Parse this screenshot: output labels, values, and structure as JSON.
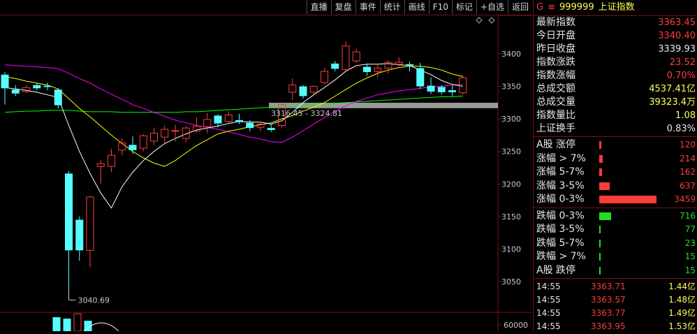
{
  "toolbar": {
    "buttons": [
      "直播",
      "复盘",
      "事件",
      "统计",
      "画线",
      "F10",
      "标记",
      "+自选",
      "返回"
    ]
  },
  "chart": {
    "ytick_labels": [
      "3400",
      "3350",
      "3300",
      "3250",
      "3200",
      "3150",
      "3100",
      "3050"
    ],
    "volume_tick_label": "60000",
    "low_annotation": "3040.69",
    "band_annotation": "3316.45 - 3324.81",
    "colors": {
      "up": "#ff3b3b",
      "down": "#54ffff",
      "ma5": "#ffffff",
      "ma10": "#ffff00",
      "ma20": "#ff00ff",
      "ma60": "#00ff00",
      "grid": "#7a1010",
      "band": "#9a9a9a"
    }
  },
  "chart_data": {
    "type": "candlestick",
    "ylim": [
      3030,
      3430
    ],
    "yticks": [
      3400,
      3350,
      3300,
      3250,
      3200,
      3150,
      3100,
      3050
    ],
    "candles": [
      {
        "o": 3368,
        "c": 3347,
        "h": 3372,
        "l": 3322
      },
      {
        "o": 3345,
        "c": 3339,
        "h": 3352,
        "l": 3335
      },
      {
        "o": 3342,
        "c": 3348,
        "h": 3352,
        "l": 3340
      },
      {
        "o": 3352,
        "c": 3347,
        "h": 3355,
        "l": 3344
      },
      {
        "o": 3351,
        "c": 3349,
        "h": 3356,
        "l": 3344
      },
      {
        "o": 3345,
        "c": 3321,
        "h": 3347,
        "l": 3316
      },
      {
        "o": 3216,
        "c": 3098,
        "h": 3220,
        "l": 3041
      },
      {
        "o": 3145,
        "c": 3098,
        "h": 3150,
        "l": 3082
      },
      {
        "o": 3098,
        "c": 3180,
        "h": 3182,
        "l": 3072
      },
      {
        "o": 3227,
        "c": 3231,
        "h": 3237,
        "l": 3200
      },
      {
        "o": 3227,
        "c": 3244,
        "h": 3254,
        "l": 3218
      },
      {
        "o": 3252,
        "c": 3263,
        "h": 3270,
        "l": 3244
      },
      {
        "o": 3260,
        "c": 3252,
        "h": 3273,
        "l": 3246
      },
      {
        "o": 3255,
        "c": 3274,
        "h": 3277,
        "l": 3250
      },
      {
        "o": 3266,
        "c": 3278,
        "h": 3286,
        "l": 3260
      },
      {
        "o": 3272,
        "c": 3284,
        "h": 3290,
        "l": 3262
      },
      {
        "o": 3281,
        "c": 3282,
        "h": 3291,
        "l": 3265
      },
      {
        "o": 3270,
        "c": 3286,
        "h": 3289,
        "l": 3264
      },
      {
        "o": 3281,
        "c": 3289,
        "h": 3302,
        "l": 3279
      },
      {
        "o": 3288,
        "c": 3299,
        "h": 3309,
        "l": 3278
      },
      {
        "o": 3305,
        "c": 3293,
        "h": 3307,
        "l": 3287
      },
      {
        "o": 3296,
        "c": 3306,
        "h": 3312,
        "l": 3293
      },
      {
        "o": 3298,
        "c": 3295,
        "h": 3308,
        "l": 3292
      },
      {
        "o": 3294,
        "c": 3286,
        "h": 3298,
        "l": 3281
      },
      {
        "o": 3287,
        "c": 3292,
        "h": 3295,
        "l": 3281
      },
      {
        "o": 3286,
        "c": 3283,
        "h": 3292,
        "l": 3280
      },
      {
        "o": 3290,
        "c": 3322,
        "h": 3325,
        "l": 3286
      },
      {
        "o": 3341,
        "c": 3352,
        "h": 3362,
        "l": 3329
      },
      {
        "o": 3350,
        "c": 3335,
        "h": 3352,
        "l": 3331
      },
      {
        "o": 3341,
        "c": 3350,
        "h": 3351,
        "l": 3337
      },
      {
        "o": 3356,
        "c": 3373,
        "h": 3378,
        "l": 3353
      },
      {
        "o": 3385,
        "c": 3377,
        "h": 3389,
        "l": 3373
      },
      {
        "o": 3376,
        "c": 3412,
        "h": 3419,
        "l": 3375
      },
      {
        "o": 3389,
        "c": 3403,
        "h": 3408,
        "l": 3386
      },
      {
        "o": 3380,
        "c": 3372,
        "h": 3385,
        "l": 3366
      },
      {
        "o": 3373,
        "c": 3378,
        "h": 3385,
        "l": 3363
      },
      {
        "o": 3378,
        "c": 3387,
        "h": 3390,
        "l": 3370
      },
      {
        "o": 3384,
        "c": 3387,
        "h": 3395,
        "l": 3381
      },
      {
        "o": 3384,
        "c": 3382,
        "h": 3388,
        "l": 3373
      },
      {
        "o": 3378,
        "c": 3350,
        "h": 3386,
        "l": 3346
      },
      {
        "o": 3351,
        "c": 3342,
        "h": 3364,
        "l": 3338
      },
      {
        "o": 3349,
        "c": 3341,
        "h": 3352,
        "l": 3337
      },
      {
        "o": 3344,
        "c": 3341,
        "h": 3351,
        "l": 3335
      },
      {
        "o": 3340,
        "c": 3363,
        "h": 3367,
        "l": 3337
      }
    ],
    "ma5": [
      3348,
      3346,
      3344,
      3341,
      3337,
      3333,
      3290,
      3250,
      3216,
      3186,
      3163,
      3196,
      3218,
      3236,
      3250,
      3262,
      3270,
      3277,
      3283,
      3286,
      3289,
      3293,
      3296,
      3295,
      3295,
      3292,
      3297,
      3310,
      3325,
      3337,
      3348,
      3360,
      3373,
      3382,
      3384,
      3384,
      3385,
      3383,
      3382,
      3375,
      3368,
      3359,
      3353,
      3350
    ],
    "ma10": [
      3365,
      3362,
      3358,
      3355,
      3352,
      3346,
      3331,
      3316,
      3303,
      3289,
      3275,
      3262,
      3250,
      3240,
      3232,
      3227,
      3236,
      3248,
      3259,
      3268,
      3277,
      3281,
      3284,
      3288,
      3291,
      3294,
      3300,
      3305,
      3312,
      3318,
      3325,
      3335,
      3345,
      3355,
      3363,
      3370,
      3375,
      3379,
      3381,
      3381,
      3379,
      3375,
      3369,
      3365
    ],
    "ma20": [
      3383,
      3382,
      3381,
      3380,
      3379,
      3377,
      3370,
      3362,
      3355,
      3346,
      3338,
      3330,
      3322,
      3316,
      3310,
      3304,
      3298,
      3294,
      3290,
      3287,
      3284,
      3280,
      3276,
      3272,
      3269,
      3265,
      3264,
      3272,
      3282,
      3292,
      3302,
      3312,
      3320,
      3327,
      3332,
      3337,
      3340,
      3343,
      3345,
      3347,
      3349,
      3350,
      3352,
      3353
    ],
    "ma60": [
      3310,
      3311,
      3312,
      3312,
      3313,
      3313,
      3313,
      3312,
      3311,
      3311,
      3311,
      3310,
      3310,
      3310,
      3310,
      3310,
      3310,
      3311,
      3311,
      3312,
      3313,
      3314,
      3315,
      3316,
      3317,
      3318,
      3319,
      3320,
      3321,
      3322,
      3323,
      3324,
      3325,
      3326,
      3327,
      3328,
      3329,
      3330,
      3331,
      3332,
      3333,
      3334,
      3334,
      3335
    ]
  },
  "header": {
    "g_label": "G",
    "menu_icon": "≡",
    "code": "999999",
    "name": "上证指数"
  },
  "quote": [
    {
      "label": "最新指数",
      "value": "3363.45",
      "color": "#ff3b3b"
    },
    {
      "label": "今日开盘",
      "value": "3340.40",
      "color": "#ff3b3b"
    },
    {
      "label": "昨日收盘",
      "value": "3339.93",
      "color": "#e8e8e8"
    },
    {
      "label": "指数涨跌",
      "value": "23.52",
      "color": "#ff3b3b"
    },
    {
      "label": "指数涨幅",
      "value": "0.70%",
      "color": "#ff3b3b"
    },
    {
      "label": "总成交额",
      "value": "4537.41亿",
      "color": "#ffff55"
    },
    {
      "label": "总成交量",
      "value": "39323.4万",
      "color": "#ffff55"
    },
    {
      "label": "指数量比",
      "value": "1.08",
      "color": "#ffff55"
    },
    {
      "label": "上证换手",
      "value": "0.83%",
      "color": "#e8e8e8"
    }
  ],
  "breadth_up": [
    {
      "label": "A股 涨停",
      "value": "120",
      "ratio": 0.035
    },
    {
      "label": "涨幅 > 7%",
      "value": "214",
      "ratio": 0.062
    },
    {
      "label": "涨幅 5-7%",
      "value": "162",
      "ratio": 0.047
    },
    {
      "label": "涨幅 3-5%",
      "value": "637",
      "ratio": 0.184
    },
    {
      "label": "涨幅 0-3%",
      "value": "3459",
      "ratio": 1.0
    }
  ],
  "breadth_down": [
    {
      "label": "跌幅 0-3%",
      "value": "716",
      "ratio": 0.207
    },
    {
      "label": "跌幅 3-5%",
      "value": "77",
      "ratio": 0.022
    },
    {
      "label": "跌幅 5-7%",
      "value": "23",
      "ratio": 0.007
    },
    {
      "label": "跌幅 > 7%",
      "value": "15",
      "ratio": 0.005
    },
    {
      "label": "A股 跌停",
      "value": "15",
      "ratio": 0.005
    }
  ],
  "ticks": [
    {
      "time": "14:55",
      "price": "3363.71",
      "amount": "1.44亿"
    },
    {
      "time": "14:55",
      "price": "3363.57",
      "amount": "1.48亿"
    },
    {
      "time": "14:55",
      "price": "3363.77",
      "amount": "1.49亿"
    },
    {
      "time": "14:55",
      "price": "3363.95",
      "amount": "1.53亿"
    }
  ]
}
